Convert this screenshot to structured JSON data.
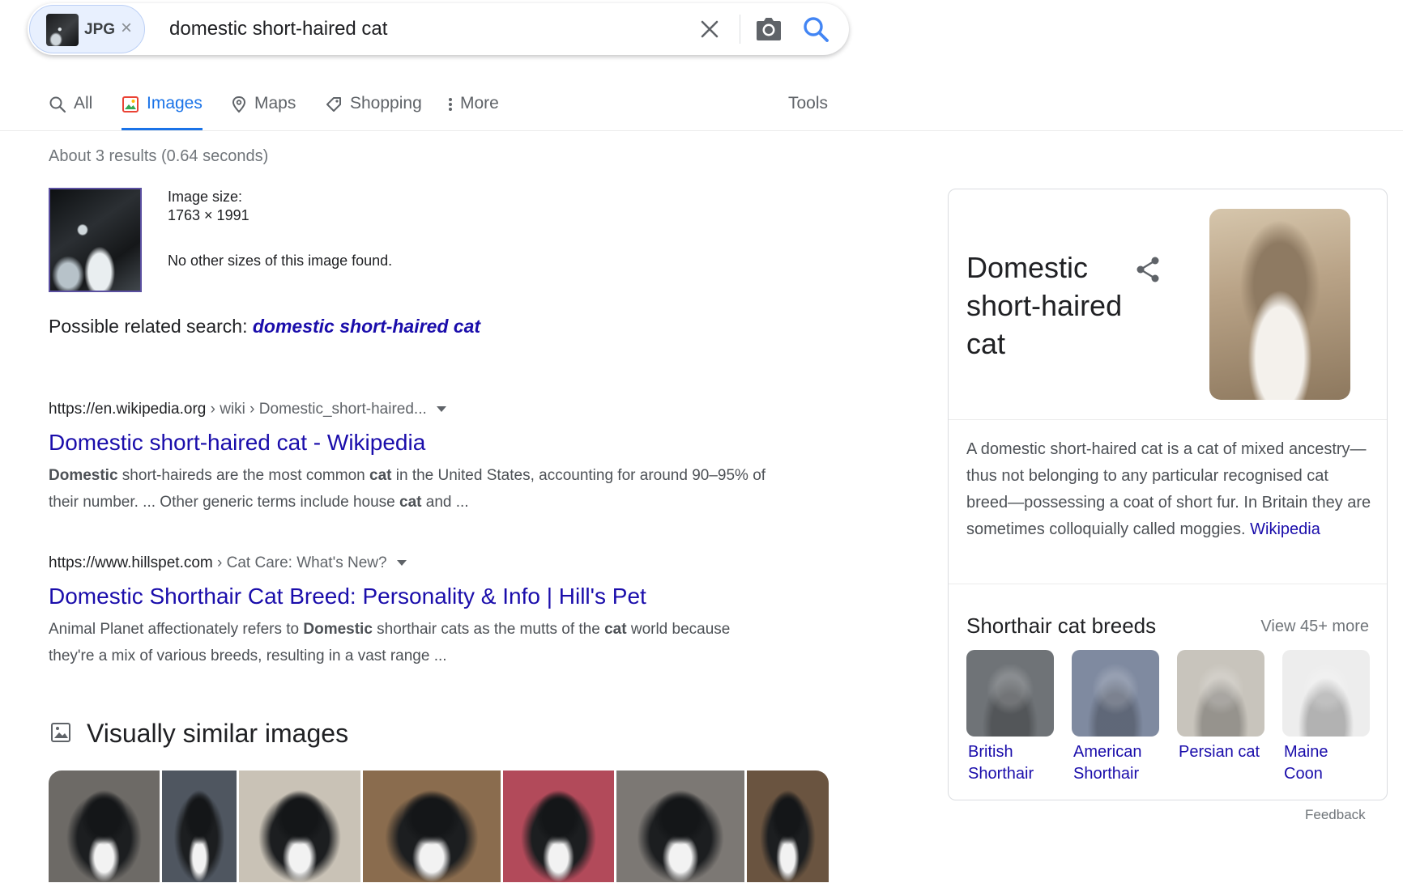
{
  "search": {
    "chip_label": "JPG",
    "query": "domestic short-haired cat"
  },
  "tabs": [
    {
      "label": "All",
      "icon": "search-icon"
    },
    {
      "label": "Images",
      "icon": "image-icon",
      "active": true
    },
    {
      "label": "Maps",
      "icon": "map-pin-icon"
    },
    {
      "label": "Shopping",
      "icon": "tag-icon"
    },
    {
      "label": "More",
      "icon": "more-vert-icon"
    }
  ],
  "tools_label": "Tools",
  "stats": "About 3 results (0.64 seconds)",
  "image_info": {
    "size_label": "Image size:",
    "size_value": "1763 × 1991",
    "no_sizes": "No other sizes of this image found."
  },
  "related": {
    "prefix": "Possible related search: ",
    "link": "domestic short-haired cat"
  },
  "results": [
    {
      "cite_domain": "https://en.wikipedia.org",
      "cite_path": " › wiki › Domestic_short-haired...",
      "title": "Domestic short-haired cat - Wikipedia",
      "snippet_html": "<b>Domestic</b> short-haireds are the most common <b>cat</b> in the United States, accounting for around 90–95% of their number. ... Other generic terms include house <b>cat</b> and ..."
    },
    {
      "cite_domain": "https://www.hillspet.com",
      "cite_path": " › Cat Care: What's New?",
      "title": "Domestic Shorthair Cat Breed: Personality & Info | Hill's Pet",
      "snippet_html": "Animal Planet affectionately refers to <b>Domestic</b> shorthair cats as the mutts of the <b>cat</b> world because they're a mix of various breeds, resulting in a vast range ..."
    }
  ],
  "similar": {
    "heading": "Visually similar images",
    "images": [
      {
        "bg": "#6d6a66"
      },
      {
        "bg": "#4f5660"
      },
      {
        "bg": "#c9c2b6"
      },
      {
        "bg": "#8a6c4e"
      },
      {
        "bg": "#b24a5a"
      },
      {
        "bg": "#7c7874"
      },
      {
        "bg": "#6a5440"
      }
    ]
  },
  "knowledge_panel": {
    "title": "Domestic short-haired cat",
    "description": "A domestic short-haired cat is a cat of mixed ancestry—thus not belonging to any particular recognised cat breed—possessing a coat of short fur. In Britain they are sometimes colloquially called moggies.",
    "source_link": "Wikipedia",
    "breeds_title": "Shorthair cat breeds",
    "more_link": "View 45+ more",
    "breeds": [
      {
        "name": "British Shorthair",
        "bg": "#6f7377"
      },
      {
        "name": "American Shorthair",
        "bg": "#7f8aa0"
      },
      {
        "name": "Persian cat",
        "bg": "#c8c4bc"
      },
      {
        "name": "Maine Coon",
        "bg": "#ededed"
      }
    ]
  },
  "feedback": "Feedback",
  "colors": {
    "link": "#1a0dab",
    "accent": "#1a73e8",
    "muted": "#5f6368"
  }
}
